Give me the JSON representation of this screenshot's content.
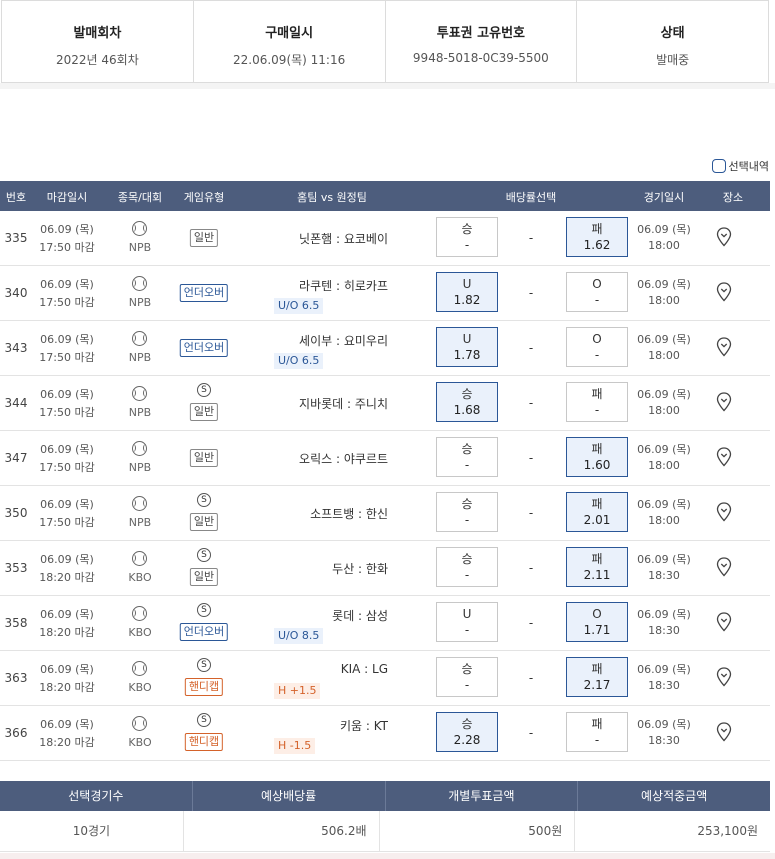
{
  "info": {
    "round_label": "발매회차",
    "round_value": "2022년 46회차",
    "purchase_label": "구매일시",
    "purchase_value": "22.06.09(목) 11:16",
    "ticket_label": "투표권 고유번호",
    "ticket_value": "9948-5018-0C39-5500",
    "status_label": "상태",
    "status_value": "발매중"
  },
  "selected_toggle": {
    "label": "선택내역"
  },
  "table": {
    "headers": {
      "no": "번호",
      "deadline": "마감일시",
      "sport": "종목/대회",
      "type": "게임유형",
      "teams": "홈팀 vs 원정팀",
      "odds": "배당률선택",
      "gamedate": "경기일시",
      "venue": "장소"
    },
    "rows": [
      {
        "no": "335",
        "d1": "06.09 (목)",
        "d2": "17:50 마감",
        "league": "NPB",
        "s": "",
        "type": "일반",
        "teams": "닛폰햄 : 요코베이",
        "sub": "",
        "home_l": "승",
        "home_o": "-",
        "draw": "-",
        "away_l": "패",
        "away_o": "1.62",
        "g1": "06.09 (목)",
        "g2": "18:00"
      },
      {
        "no": "340",
        "d1": "06.09 (목)",
        "d2": "17:50 마감",
        "league": "NPB",
        "s": "",
        "type": "언더오버",
        "teams": "라쿠텐 : 히로카프",
        "sub": "U/O 6.5",
        "home_l": "U",
        "home_o": "1.82",
        "draw": "-",
        "away_l": "O",
        "away_o": "-",
        "g1": "06.09 (목)",
        "g2": "18:00"
      },
      {
        "no": "343",
        "d1": "06.09 (목)",
        "d2": "17:50 마감",
        "league": "NPB",
        "s": "",
        "type": "언더오버",
        "teams": "세이부 : 요미우리",
        "sub": "U/O 6.5",
        "home_l": "U",
        "home_o": "1.78",
        "draw": "-",
        "away_l": "O",
        "away_o": "-",
        "g1": "06.09 (목)",
        "g2": "18:00"
      },
      {
        "no": "344",
        "d1": "06.09 (목)",
        "d2": "17:50 마감",
        "league": "NPB",
        "s": "S",
        "type": "일반",
        "teams": "지바롯데 : 주니치",
        "sub": "",
        "home_l": "승",
        "home_o": "1.68",
        "draw": "-",
        "away_l": "패",
        "away_o": "-",
        "g1": "06.09 (목)",
        "g2": "18:00"
      },
      {
        "no": "347",
        "d1": "06.09 (목)",
        "d2": "17:50 마감",
        "league": "NPB",
        "s": "",
        "type": "일반",
        "teams": "오릭스 : 야쿠르트",
        "sub": "",
        "home_l": "승",
        "home_o": "-",
        "draw": "-",
        "away_l": "패",
        "away_o": "1.60",
        "g1": "06.09 (목)",
        "g2": "18:00"
      },
      {
        "no": "350",
        "d1": "06.09 (목)",
        "d2": "17:50 마감",
        "league": "NPB",
        "s": "S",
        "type": "일반",
        "teams": "소프트뱅 : 한신",
        "sub": "",
        "home_l": "승",
        "home_o": "-",
        "draw": "-",
        "away_l": "패",
        "away_o": "2.01",
        "g1": "06.09 (목)",
        "g2": "18:00"
      },
      {
        "no": "353",
        "d1": "06.09 (목)",
        "d2": "18:20 마감",
        "league": "KBO",
        "s": "S",
        "type": "일반",
        "teams": "두산 : 한화",
        "sub": "",
        "home_l": "승",
        "home_o": "-",
        "draw": "-",
        "away_l": "패",
        "away_o": "2.11",
        "g1": "06.09 (목)",
        "g2": "18:30"
      },
      {
        "no": "358",
        "d1": "06.09 (목)",
        "d2": "18:20 마감",
        "league": "KBO",
        "s": "S",
        "type": "언더오버",
        "teams": "롯데 : 삼성",
        "sub": "U/O 8.5",
        "home_l": "U",
        "home_o": "-",
        "draw": "-",
        "away_l": "O",
        "away_o": "1.71",
        "g1": "06.09 (목)",
        "g2": "18:30"
      },
      {
        "no": "363",
        "d1": "06.09 (목)",
        "d2": "18:20 마감",
        "league": "KBO",
        "s": "S",
        "type": "핸디캡",
        "teams": "KIA : LG",
        "sub": "H +1.5",
        "home_l": "승",
        "home_o": "-",
        "draw": "-",
        "away_l": "패",
        "away_o": "2.17",
        "g1": "06.09 (목)",
        "g2": "18:30"
      },
      {
        "no": "366",
        "d1": "06.09 (목)",
        "d2": "18:20 마감",
        "league": "KBO",
        "s": "S",
        "type": "핸디캡",
        "teams": "키움 : KT",
        "sub": "H -1.5",
        "home_l": "승",
        "home_o": "2.28",
        "draw": "-",
        "away_l": "패",
        "away_o": "-",
        "g1": "06.09 (목)",
        "g2": "18:30"
      }
    ]
  },
  "summary": {
    "h1": "선택경기수",
    "h2": "예상배당률",
    "h3": "개별투표금액",
    "h4": "예상적중금액",
    "v1": "10경기",
    "v2": "506.2배",
    "v3": "500원",
    "v4": "253,100원"
  }
}
